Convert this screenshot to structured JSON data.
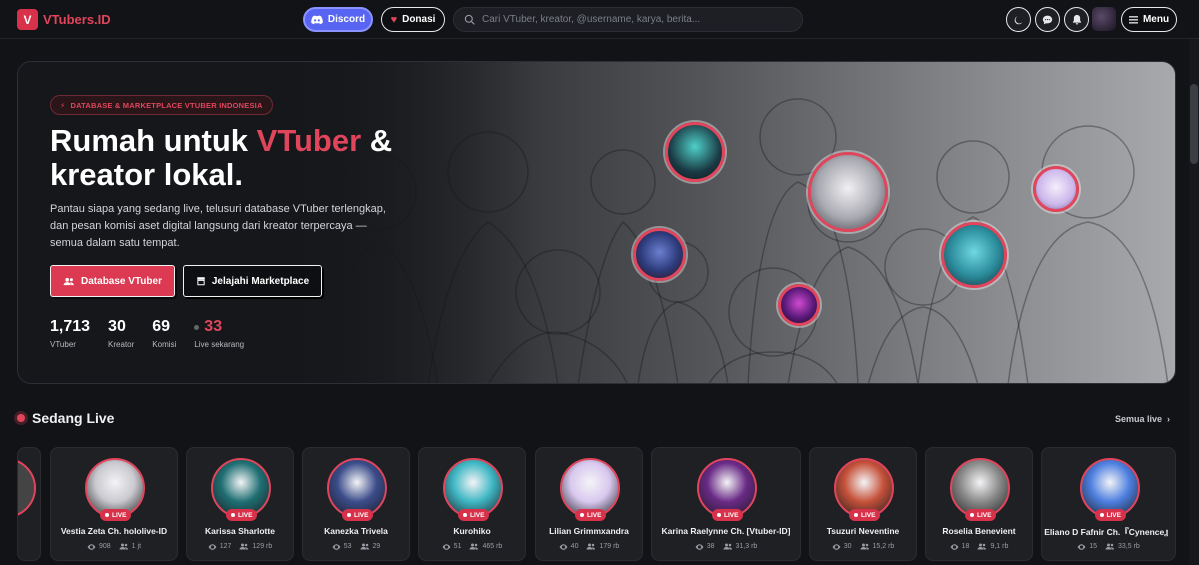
{
  "nav": {
    "logo_mark": "V",
    "logo_text": "VTubers.ID",
    "discord_label": "Discord",
    "donasi_label": "Donasi",
    "search_placeholder": "Cari VTuber, kreator, @username, karya, berita...",
    "menu_label": "Menu"
  },
  "hero": {
    "badge": "DATABASE & MARKETPLACE VTUBER INDONESIA",
    "title_part1": "Rumah untuk ",
    "title_accent": "VTuber",
    "title_part2": " & kreator lokal.",
    "description": "Pantau siapa yang sedang live, telusuri database VTuber terlengkap, dan pesan komisi aset digital langsung dari kreator terpercaya — semua dalam satu tempat.",
    "primary_button": "Database VTuber",
    "secondary_button": "Jelajahi Marketplace",
    "stats": [
      {
        "value": "1,713",
        "label": "VTuber"
      },
      {
        "value": "30",
        "label": "Kreator"
      },
      {
        "value": "69",
        "label": "Komisi"
      },
      {
        "value": "33",
        "label": "Live sekarang"
      }
    ]
  },
  "live": {
    "title": "Sedang Live",
    "see_all": "Semua live",
    "badge": "LIVE",
    "cards": [
      {
        "name": "Vestia Zeta Ch. hololive-ID",
        "viewers": "908",
        "followers": "1 jt",
        "color": "#c9c9cf"
      },
      {
        "name": "Karissa Sharlotte",
        "viewers": "127",
        "followers": "129 rb",
        "color": "#1f6f73"
      },
      {
        "name": "Kanezka Trivela",
        "viewers": "53",
        "followers": "29",
        "color": "#3b4c8a"
      },
      {
        "name": "Kurohiko",
        "viewers": "51",
        "followers": "465 rb",
        "color": "#3fb7c4"
      },
      {
        "name": "Lilian Grimmxandra",
        "viewers": "40",
        "followers": "179 rb",
        "color": "#d9c8ef"
      },
      {
        "name": "Karina Raelynne Ch. [Vtuber-ID]",
        "viewers": "38",
        "followers": "31,3 rb",
        "color": "#6a2a86"
      },
      {
        "name": "Tsuzuri Neventine",
        "viewers": "30",
        "followers": "15,2 rb",
        "color": "#c5513a"
      },
      {
        "name": "Roselia Benevient",
        "viewers": "18",
        "followers": "9,1 rb",
        "color": "#8a8a8a"
      },
      {
        "name": "Eliano D Fafnir Ch.『Cynence』",
        "viewers": "15",
        "followers": "33,5 rb",
        "color": "#4d7fe0"
      }
    ]
  }
}
